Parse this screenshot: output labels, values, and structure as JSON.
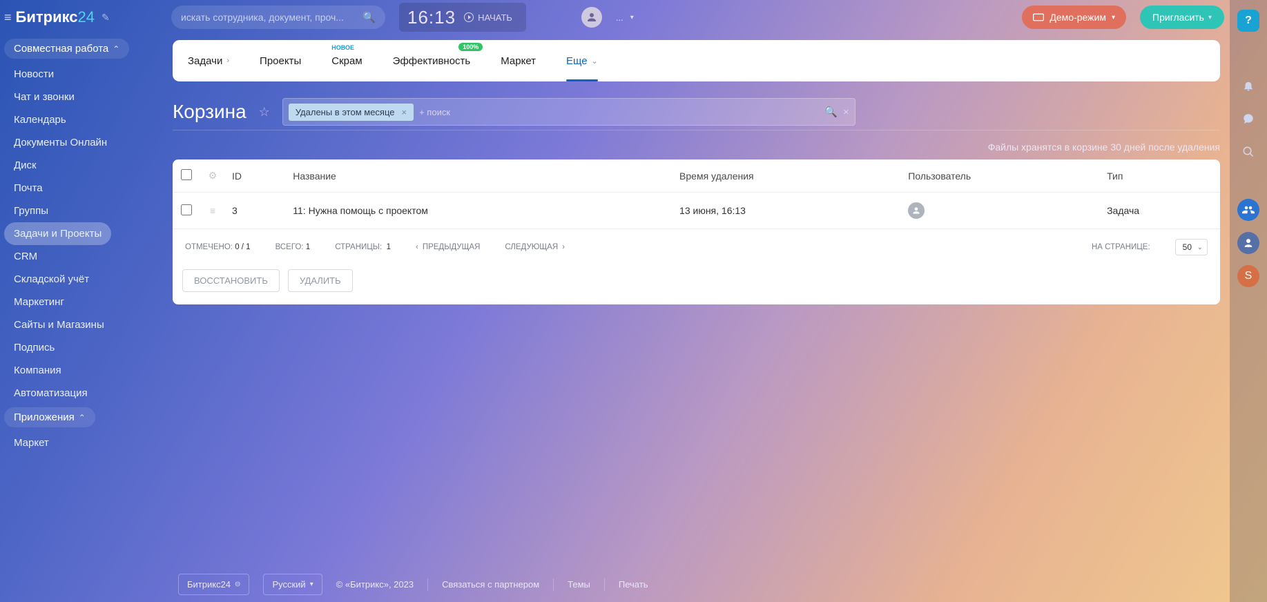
{
  "logo": {
    "part1": "Битрикс",
    "part2": "24"
  },
  "global_search": {
    "placeholder": "искать сотрудника, документ, проч..."
  },
  "clock": {
    "time": "16:13",
    "start": "НАЧАТЬ"
  },
  "user_status": {
    "label": "..."
  },
  "buttons": {
    "demo": "Демо-режим",
    "invite": "Пригласить"
  },
  "tabs": [
    {
      "label": "Задачи",
      "sub": true
    },
    {
      "label": "Проекты"
    },
    {
      "label": "Скрам",
      "badge_new": "НОВОЕ"
    },
    {
      "label": "Эффективность",
      "badge_pct": "100%"
    },
    {
      "label": "Маркет"
    },
    {
      "label": "Еще",
      "sub": true,
      "active": true
    }
  ],
  "sidebar": {
    "groups": [
      {
        "title": "Совместная работа",
        "items": [
          "Новости",
          "Чат и звонки",
          "Календарь",
          "Документы Онлайн",
          "Диск",
          "Почта",
          "Группы",
          "Задачи и Проекты",
          "CRM",
          "Складской учёт",
          "Маркетинг",
          "Сайты и Магазины",
          "Подпись",
          "Компания",
          "Автоматизация"
        ],
        "active_index": 7
      },
      {
        "title": "Приложения",
        "items": [
          "Маркет"
        ]
      }
    ]
  },
  "page": {
    "title": "Корзина",
    "filter_chip": "Удалены в этом месяце",
    "filter_placeholder": "+ поиск",
    "retention": "Файлы хранятся в корзине 30 дней после удаления"
  },
  "table": {
    "cols": [
      "ID",
      "Название",
      "Время удаления",
      "Пользователь",
      "Тип"
    ],
    "rows": [
      {
        "id": "3",
        "name": "11: Нужна помощь с проектом",
        "deleted": "13 июня, 16:13",
        "type": "Задача"
      }
    ]
  },
  "pager": {
    "selected_label": "ОТМЕЧЕНО:",
    "selected_val": "0 / 1",
    "total_label": "ВСЕГО:",
    "total_val": "1",
    "pages_label": "СТРАНИЦЫ:",
    "pages_val": "1",
    "prev": "ПРЕДЫДУЩАЯ",
    "next": "СЛЕДУЮЩАЯ",
    "perpage_label": "НА СТРАНИЦЕ:",
    "perpage_val": "50"
  },
  "actions": {
    "restore": "ВОССТАНОВИТЬ",
    "delete": "УДАЛИТЬ"
  },
  "footer": {
    "brand": "Битрикс24",
    "lang": "Русский",
    "copyright": "© «Битрикс», 2023",
    "partner": "Связаться с партнером",
    "themes": "Темы",
    "print": "Печать"
  },
  "rail_initial": "S"
}
